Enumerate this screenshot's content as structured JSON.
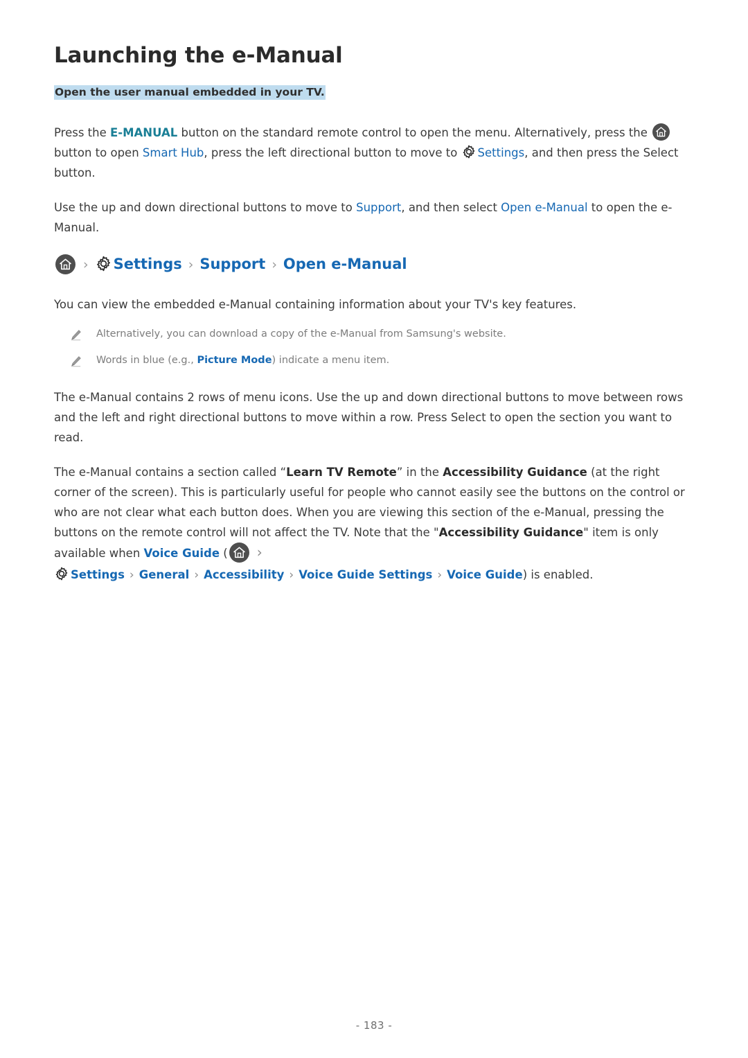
{
  "page": {
    "title": "Launching the e-Manual",
    "subtitle": "Open the user manual embedded in your TV.",
    "page_number": "- 183 -"
  },
  "colors": {
    "link_blue": "#1668b3",
    "link_teal": "#1a7f96",
    "highlight_bg": "#bfdcef",
    "home_icon_bg": "#4e4e4e",
    "note_text": "#7c7c7c",
    "body_text": "#3b3b3b"
  },
  "paragraphs": {
    "p1": {
      "s1": "Press the ",
      "link_emanual": "E-MANUAL",
      "s2": " button on the standard remote control to open the menu. Alternatively, press the ",
      "s3": " button to open ",
      "link_smart_hub": "Smart Hub",
      "s4": ", press the left directional button to move to ",
      "link_settings": "Settings",
      "s5": ", and then press the Select button."
    },
    "p2": {
      "s1": "Use the up and down directional buttons to move to ",
      "link_support": "Support",
      "s2": ", and then select ",
      "link_open_emanual": "Open e-Manual",
      "s3": " to open the e-Manual."
    },
    "p3": {
      "s1": "You can view the embedded e-Manual containing information about your TV's key features."
    },
    "p4": {
      "s1": "The e-Manual contains 2 rows of menu icons. Use the up and down directional buttons to move between rows and the left and right directional buttons to move within a row. Press Select to open the section you want to read."
    },
    "p5": {
      "s1": "The e-Manual contains a section called “",
      "bold_learn_tv_remote": "Learn TV Remote",
      "s2": "” in the ",
      "bold_accessibility_guidance": "Accessibility Guidance",
      "s3": " (at the right corner of the screen). This is particularly useful for people who cannot easily see the buttons on the control or who are not clear what each button does. When you are viewing this section of the e-Manual, pressing the buttons on the remote control will not affect the TV. Note that the \"",
      "bold_accessibility_guidance_2": "Accessibility Guidance",
      "s4": "\" item is only available when ",
      "link_voice_guide": "Voice Guide",
      "s5": " ("
    }
  },
  "breadcrumb": {
    "home_icon": "home-icon",
    "separator": "›",
    "items": [
      {
        "label": "Settings",
        "icon": "gear-icon"
      },
      {
        "label": "Support",
        "icon": ""
      },
      {
        "label": "Open e-Manual",
        "icon": ""
      }
    ]
  },
  "inline_path": {
    "items": [
      {
        "label": "Settings",
        "icon": "gear-icon"
      },
      {
        "label": "General",
        "icon": ""
      },
      {
        "label": "Accessibility",
        "icon": ""
      },
      {
        "label": "Voice Guide Settings",
        "icon": ""
      },
      {
        "label": "Voice Guide",
        "icon": ""
      }
    ],
    "tail": ") is enabled."
  },
  "notes": [
    {
      "icon": "pencil-icon",
      "text_before": "Alternatively, you can download a copy of the e-Manual from Samsung's website.",
      "link": "",
      "text_after": ""
    },
    {
      "icon": "pencil-icon",
      "text_before": "Words in blue (e.g., ",
      "link": "Picture Mode",
      "text_after": ") indicate a menu item."
    }
  ]
}
